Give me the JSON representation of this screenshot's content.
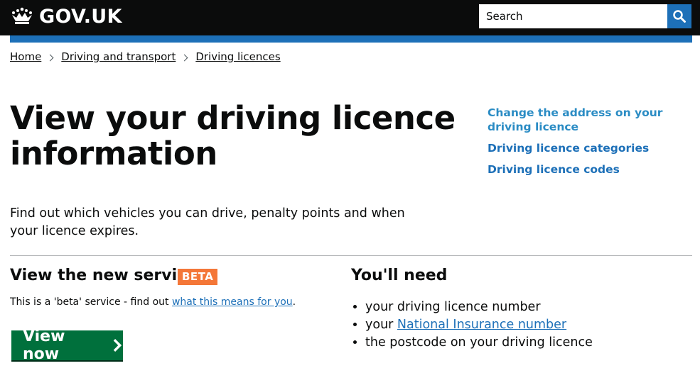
{
  "header": {
    "logo_text": "GOV.UK",
    "search_placeholder": "Search",
    "search_icon": "search-icon"
  },
  "breadcrumbs": [
    {
      "label": "Home"
    },
    {
      "label": "Driving and transport"
    },
    {
      "label": "Driving licences"
    }
  ],
  "page": {
    "title": "View your driving licence information",
    "lede": "Find out which vehicles you can drive, penalty points and when your licence expires."
  },
  "related_links": [
    {
      "label": "Change the address on your driving licence"
    },
    {
      "label": "Driving licence categories"
    },
    {
      "label": "Driving licence codes"
    }
  ],
  "new_service": {
    "heading": "View the new service",
    "badge": "BETA",
    "note_prefix": "This is a 'beta' service - find out ",
    "note_link": "what this means for you",
    "note_suffix": ".",
    "button_label": "View now"
  },
  "you_need": {
    "heading": "You'll need",
    "items": [
      {
        "text": "your driving licence number",
        "link": ""
      },
      {
        "text": "your ",
        "link": "National Insurance number"
      },
      {
        "text": "the postcode on your driving licence",
        "link": ""
      }
    ]
  },
  "colors": {
    "header_bg": "#0b0c0c",
    "brand_blue": "#1d70b8",
    "button_green": "#00703c",
    "beta_orange": "#f47738"
  }
}
